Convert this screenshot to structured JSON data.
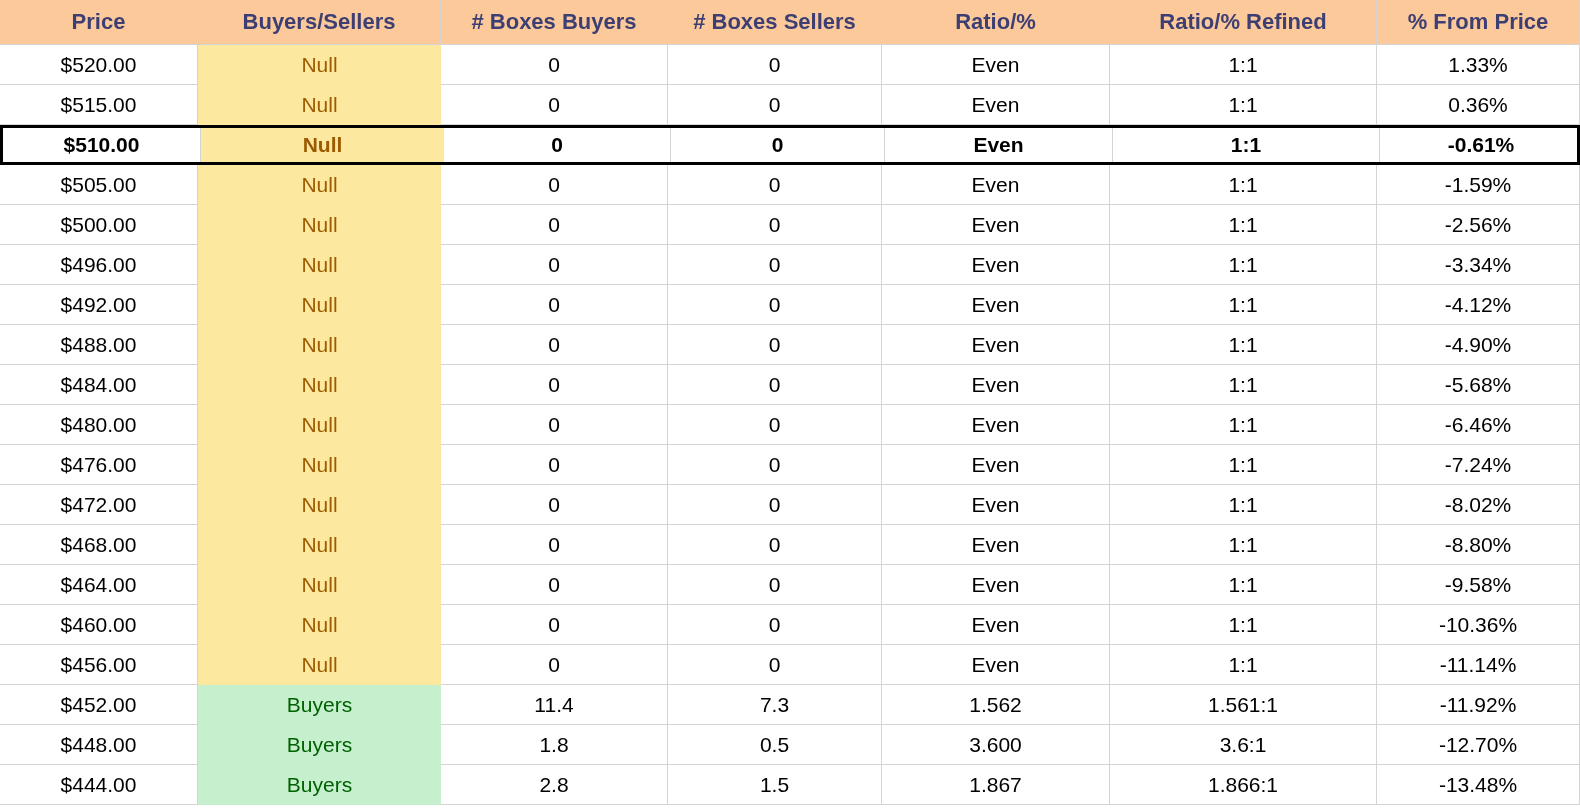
{
  "table": {
    "columns": [
      "Price",
      "Buyers/Sellers",
      "# Boxes Buyers",
      "# Boxes Sellers",
      "Ratio/%",
      "Ratio/% Refined",
      "% From Price"
    ],
    "rows": [
      {
        "price": "$520.00",
        "side": "Null",
        "kind": "null",
        "boxes_buyers": "0",
        "boxes_sellers": "0",
        "ratio": "Even",
        "ratio_refined": "1:1",
        "from_price": "1.33%",
        "selected": false
      },
      {
        "price": "$515.00",
        "side": "Null",
        "kind": "null",
        "boxes_buyers": "0",
        "boxes_sellers": "0",
        "ratio": "Even",
        "ratio_refined": "1:1",
        "from_price": "0.36%",
        "selected": false
      },
      {
        "price": "$510.00",
        "side": "Null",
        "kind": "null",
        "boxes_buyers": "0",
        "boxes_sellers": "0",
        "ratio": "Even",
        "ratio_refined": "1:1",
        "from_price": "-0.61%",
        "selected": true
      },
      {
        "price": "$505.00",
        "side": "Null",
        "kind": "null",
        "boxes_buyers": "0",
        "boxes_sellers": "0",
        "ratio": "Even",
        "ratio_refined": "1:1",
        "from_price": "-1.59%",
        "selected": false
      },
      {
        "price": "$500.00",
        "side": "Null",
        "kind": "null",
        "boxes_buyers": "0",
        "boxes_sellers": "0",
        "ratio": "Even",
        "ratio_refined": "1:1",
        "from_price": "-2.56%",
        "selected": false
      },
      {
        "price": "$496.00",
        "side": "Null",
        "kind": "null",
        "boxes_buyers": "0",
        "boxes_sellers": "0",
        "ratio": "Even",
        "ratio_refined": "1:1",
        "from_price": "-3.34%",
        "selected": false
      },
      {
        "price": "$492.00",
        "side": "Null",
        "kind": "null",
        "boxes_buyers": "0",
        "boxes_sellers": "0",
        "ratio": "Even",
        "ratio_refined": "1:1",
        "from_price": "-4.12%",
        "selected": false
      },
      {
        "price": "$488.00",
        "side": "Null",
        "kind": "null",
        "boxes_buyers": "0",
        "boxes_sellers": "0",
        "ratio": "Even",
        "ratio_refined": "1:1",
        "from_price": "-4.90%",
        "selected": false
      },
      {
        "price": "$484.00",
        "side": "Null",
        "kind": "null",
        "boxes_buyers": "0",
        "boxes_sellers": "0",
        "ratio": "Even",
        "ratio_refined": "1:1",
        "from_price": "-5.68%",
        "selected": false
      },
      {
        "price": "$480.00",
        "side": "Null",
        "kind": "null",
        "boxes_buyers": "0",
        "boxes_sellers": "0",
        "ratio": "Even",
        "ratio_refined": "1:1",
        "from_price": "-6.46%",
        "selected": false
      },
      {
        "price": "$476.00",
        "side": "Null",
        "kind": "null",
        "boxes_buyers": "0",
        "boxes_sellers": "0",
        "ratio": "Even",
        "ratio_refined": "1:1",
        "from_price": "-7.24%",
        "selected": false
      },
      {
        "price": "$472.00",
        "side": "Null",
        "kind": "null",
        "boxes_buyers": "0",
        "boxes_sellers": "0",
        "ratio": "Even",
        "ratio_refined": "1:1",
        "from_price": "-8.02%",
        "selected": false
      },
      {
        "price": "$468.00",
        "side": "Null",
        "kind": "null",
        "boxes_buyers": "0",
        "boxes_sellers": "0",
        "ratio": "Even",
        "ratio_refined": "1:1",
        "from_price": "-8.80%",
        "selected": false
      },
      {
        "price": "$464.00",
        "side": "Null",
        "kind": "null",
        "boxes_buyers": "0",
        "boxes_sellers": "0",
        "ratio": "Even",
        "ratio_refined": "1:1",
        "from_price": "-9.58%",
        "selected": false
      },
      {
        "price": "$460.00",
        "side": "Null",
        "kind": "null",
        "boxes_buyers": "0",
        "boxes_sellers": "0",
        "ratio": "Even",
        "ratio_refined": "1:1",
        "from_price": "-10.36%",
        "selected": false
      },
      {
        "price": "$456.00",
        "side": "Null",
        "kind": "null",
        "boxes_buyers": "0",
        "boxes_sellers": "0",
        "ratio": "Even",
        "ratio_refined": "1:1",
        "from_price": "-11.14%",
        "selected": false
      },
      {
        "price": "$452.00",
        "side": "Buyers",
        "kind": "buyers",
        "boxes_buyers": "11.4",
        "boxes_sellers": "7.3",
        "ratio": "1.562",
        "ratio_refined": "1.561:1",
        "from_price": "-11.92%",
        "selected": false
      },
      {
        "price": "$448.00",
        "side": "Buyers",
        "kind": "buyers",
        "boxes_buyers": "1.8",
        "boxes_sellers": "0.5",
        "ratio": "3.600",
        "ratio_refined": "3.6:1",
        "from_price": "-12.70%",
        "selected": false
      },
      {
        "price": "$444.00",
        "side": "Buyers",
        "kind": "buyers",
        "boxes_buyers": "2.8",
        "boxes_sellers": "1.5",
        "ratio": "1.867",
        "ratio_refined": "1.866:1",
        "from_price": "-13.48%",
        "selected": false
      }
    ]
  }
}
